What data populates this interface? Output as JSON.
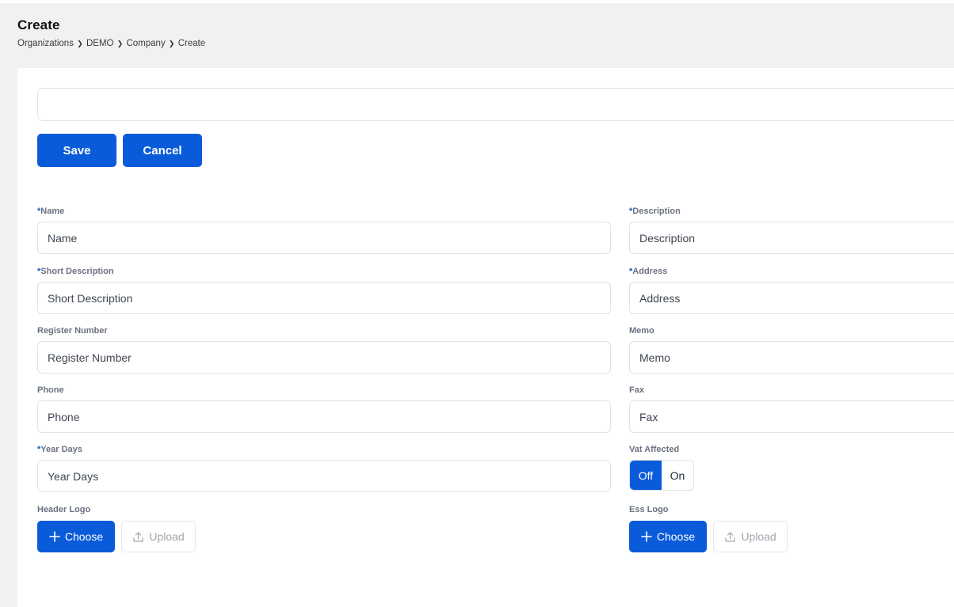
{
  "page": {
    "title": "Create",
    "breadcrumb": [
      "Organizations",
      "DEMO",
      "Company",
      "Create"
    ]
  },
  "top_input": {
    "value": "",
    "placeholder": ""
  },
  "actions": {
    "save_label": "Save",
    "cancel_label": "Cancel"
  },
  "form": {
    "required_marker": "*",
    "name": {
      "label": "Name",
      "placeholder": "Name"
    },
    "description": {
      "label": "Description",
      "placeholder": "Description"
    },
    "short_description": {
      "label": "Short Description",
      "placeholder": "Short Description"
    },
    "address": {
      "label": "Address",
      "placeholder": "Address"
    },
    "register_number": {
      "label": "Register Number",
      "placeholder": "Register Number"
    },
    "memo": {
      "label": "Memo",
      "placeholder": "Memo"
    },
    "phone": {
      "label": "Phone",
      "placeholder": "Phone"
    },
    "fax": {
      "label": "Fax",
      "placeholder": "Fax"
    },
    "year_days": {
      "label": "Year Days",
      "placeholder": "Year Days"
    },
    "vat_affected": {
      "label": "Vat Affected",
      "options": [
        "Off",
        "On"
      ],
      "selected": "Off"
    },
    "header_logo": {
      "label": "Header Logo",
      "choose_label": "Choose",
      "upload_label": "Upload"
    },
    "ess_logo": {
      "label": "Ess Logo",
      "choose_label": "Choose",
      "upload_label": "Upload"
    }
  },
  "icons": {
    "choose": "plus-icon",
    "upload": "upload-icon",
    "breadcrumb_separator": "chevron-right-icon"
  },
  "colors": {
    "accent": "#0a5bd9",
    "background": "#f1f1f1",
    "card": "#ffffff"
  }
}
